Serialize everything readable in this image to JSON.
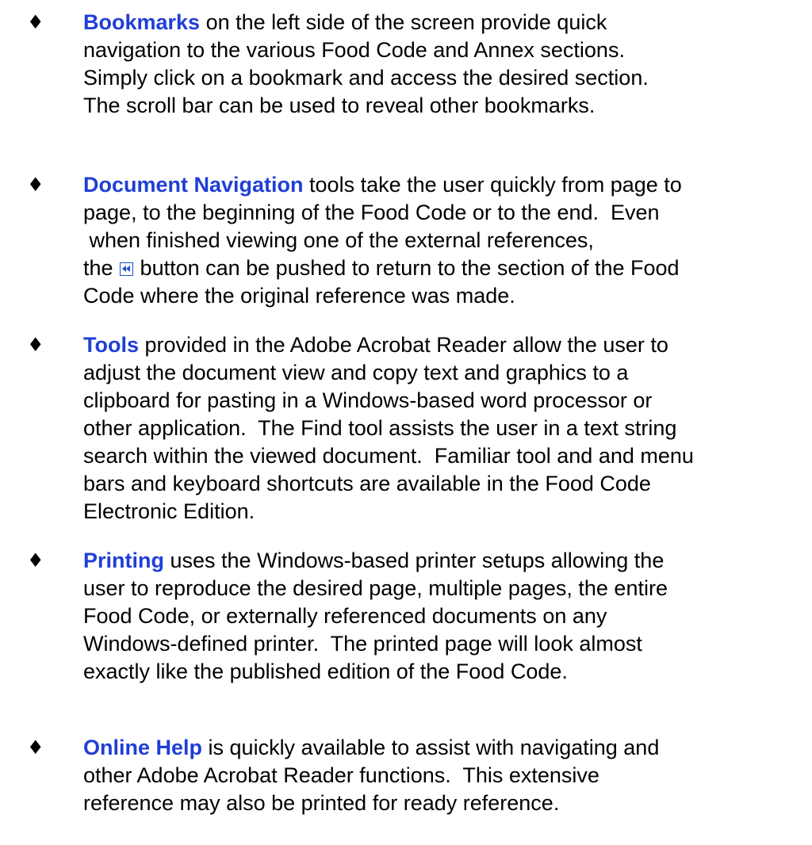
{
  "bullet_glyph": "♦",
  "items": [
    {
      "term": "Bookmarks",
      "lines": [
        " on the left side of the screen provide quick",
        "navigation to the various Food Code and Annex sections.",
        "Simply click on a bookmark and access the desired section.",
        "The scroll bar can be used to reveal other bookmarks."
      ]
    },
    {
      "term": "Document Navigation",
      "lines": [
        " tools take the user quickly from page to",
        "page, to the beginning of the Food Code or to the end.  Even",
        " when finished viewing one of the external references,",
        "the ",
        " button can be pushed to return to the section of the Food",
        "Code where the original reference was made."
      ]
    },
    {
      "term": "Tools",
      "lines": [
        " provided in the Adobe Acrobat Reader allow the user to",
        "adjust the document view and copy text and graphics to a",
        "clipboard for pasting in a Windows-based word processor or",
        "other application.  The Find tool assists the user in a text string",
        "search within the viewed document.  Familiar tool and and menu",
        "bars and keyboard shortcuts are available in the Food Code",
        "Electronic Edition."
      ]
    },
    {
      "term": "Printing",
      "lines": [
        " uses the Windows-based printer setups allowing the",
        "user to reproduce the desired page, multiple pages, the entire",
        "Food Code, or externally referenced documents on any",
        "Windows-defined printer.  The printed page will look almost",
        "exactly like the published edition of the Food Code."
      ]
    },
    {
      "term": "Online Help",
      "lines": [
        " is quickly available to assist with navigating and",
        "other Adobe Acrobat Reader functions.  This extensive",
        "reference may also be printed for ready reference."
      ]
    }
  ],
  "icons": {
    "go_back": "go-back-icon"
  },
  "colors": {
    "term": "#1f3fd6",
    "text": "#000000",
    "icon_border": "#1f4fcf"
  }
}
